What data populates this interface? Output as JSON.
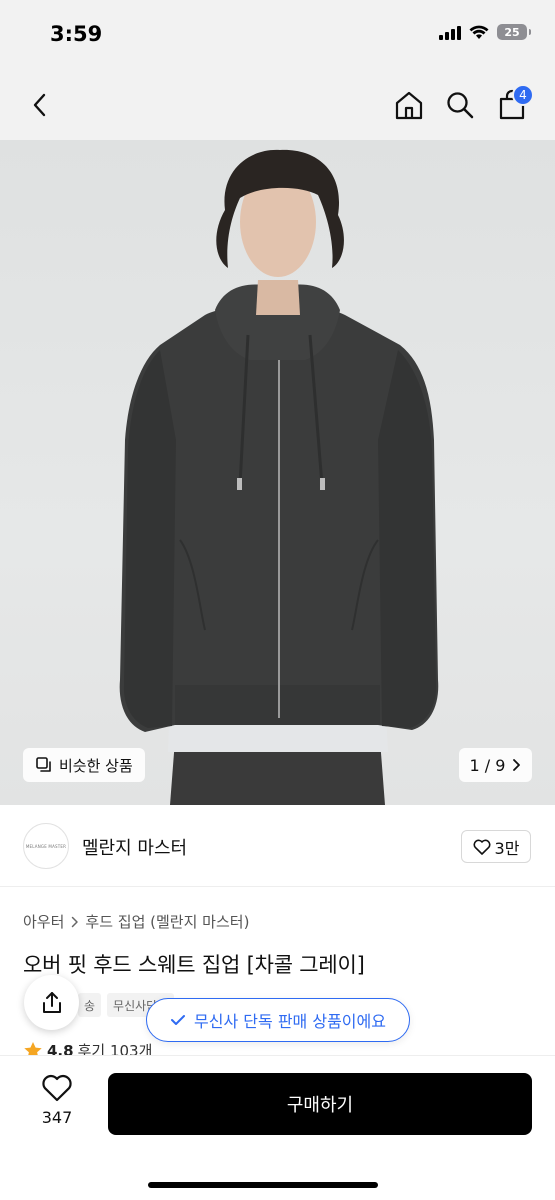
{
  "status_bar": {
    "time": "3:59",
    "battery": "25"
  },
  "nav": {
    "back_icon": "chevron-left-icon",
    "home_icon": "home-icon",
    "search_icon": "search-icon",
    "cart_icon": "shopping-bag-icon",
    "cart_count": "4"
  },
  "image": {
    "similar_label": "비슷한 상품",
    "counter": "1 / 9"
  },
  "brand": {
    "logo_text": "MELANGE MASTER",
    "name": "멜란지 마스터",
    "like_count": "3만"
  },
  "product": {
    "breadcrumb": [
      "아우터",
      "후드 집업 (멜란지 마스터)"
    ],
    "title": "오버 핏 후드 스웨트 집업 [차콜 그레이]",
    "tags": [
      "송",
      "무신사단독"
    ],
    "rating": "4.8",
    "reviews": "후기 103개"
  },
  "toast": {
    "exclusive_text": "무신사 단독 판매 상품이에요"
  },
  "bottom": {
    "wish_count": "347",
    "buy_label": "구매하기"
  },
  "colors": {
    "accent": "#2f6bf2",
    "star": "#f5a623",
    "buy_button": "#000000"
  }
}
